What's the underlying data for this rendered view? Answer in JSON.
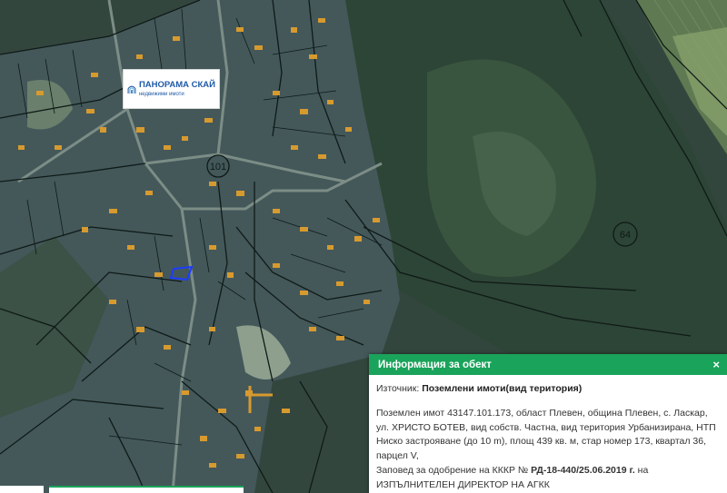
{
  "logo": {
    "name": "ПАНОРАМА СКАЙ",
    "subtitle": "недвижими имоти",
    "icon": "panorama-building-icon"
  },
  "map": {
    "road_labels": [
      "101",
      "64"
    ],
    "colors": {
      "forest": "#2f4a3c",
      "village": "#44585a",
      "field": "#6c8a5c",
      "building": "#d79a2e",
      "parcel_lines": "#0f1a17",
      "highlight": "#1c3cff"
    }
  },
  "info_panel": {
    "title": "Информация за обект",
    "close_label": "×",
    "source_label": "Източник:",
    "source_value": "Поземлени имоти(вид територия)",
    "description_lines": [
      "Поземлен имот 43147.101.173, област Плевен, община Плевен, с. Ласкар,",
      "ул. ХРИСТО БОТЕВ, вид собств. Частна, вид територия Урбанизирана, НТП",
      "Ниско застрояване (до 10 m), площ 439 кв. м, стар номер 173, квартал 36,",
      "парцел V,"
    ],
    "order_prefix": "Заповед за одобрение на КККР №",
    "order_number": "РД-18-440/25.06.2019 г.",
    "order_suffix": "на",
    "order_line2": "ИЗПЪЛНИТЕЛЕН ДИРЕКТОР НА АГКК",
    "header_color": "#1aa35a"
  }
}
